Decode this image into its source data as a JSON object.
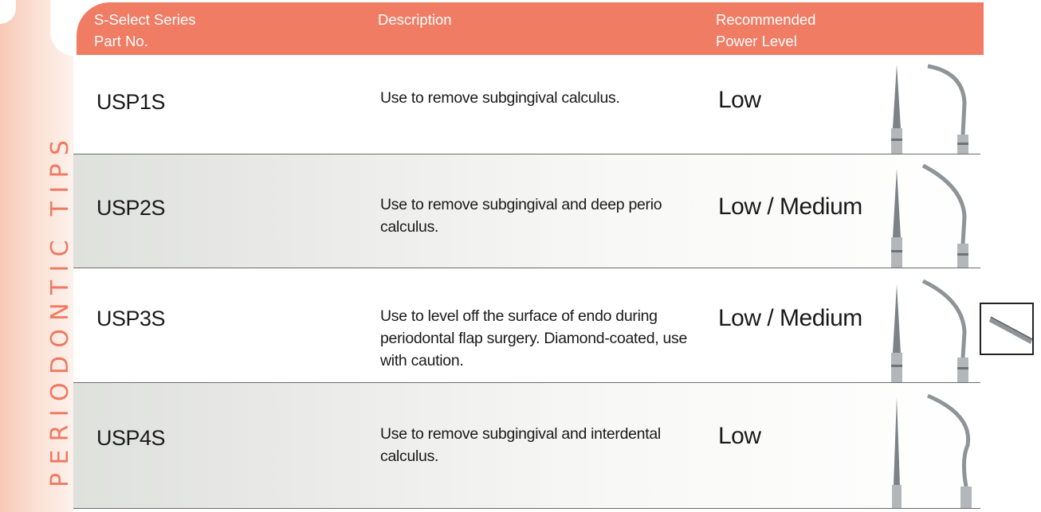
{
  "side_title": "PERIODONTIC TIPS",
  "header": {
    "part_no": "S-Select Series\nPart No.",
    "description": "Description",
    "power_level": "Recommended\nPower Level"
  },
  "rows": [
    {
      "part": "USP1S",
      "description": "Use to remove subgingival calculus.",
      "power": "Low"
    },
    {
      "part": "USP2S",
      "description": "Use to remove subgingival and deep perio calculus.",
      "power": "Low / Medium"
    },
    {
      "part": "USP3S",
      "description": "Use to level off the surface of endo during periodontal flap surgery. Diamond-coated, use with caution.",
      "power": "Low / Medium"
    },
    {
      "part": "USP4S",
      "description": "Use to remove subgingival and interdental calculus.",
      "power": "Low"
    }
  ],
  "colors": {
    "accent": "#f07c64",
    "side_text": "#f07860",
    "side_tab": "#f7c9b6",
    "row_shade": "#dfe1dd",
    "text": "#1a1a1a",
    "metal": "#9ea3a6"
  },
  "icons": [
    "dental-tip-straight-icon",
    "dental-tip-curved-icon",
    "diamond-coated-detail-icon"
  ]
}
